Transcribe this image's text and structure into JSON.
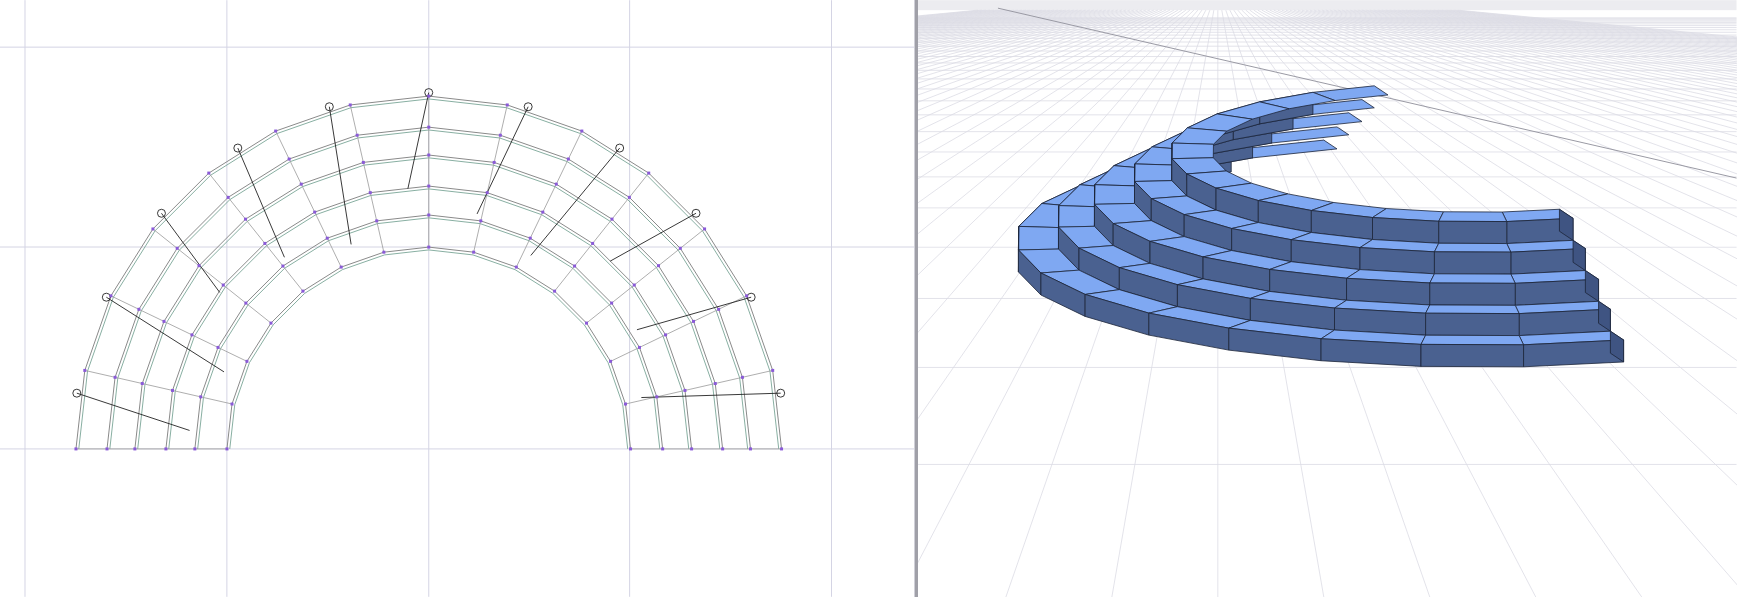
{
  "views": [
    {
      "kind": "plan"
    },
    {
      "kind": "perspective"
    }
  ]
}
